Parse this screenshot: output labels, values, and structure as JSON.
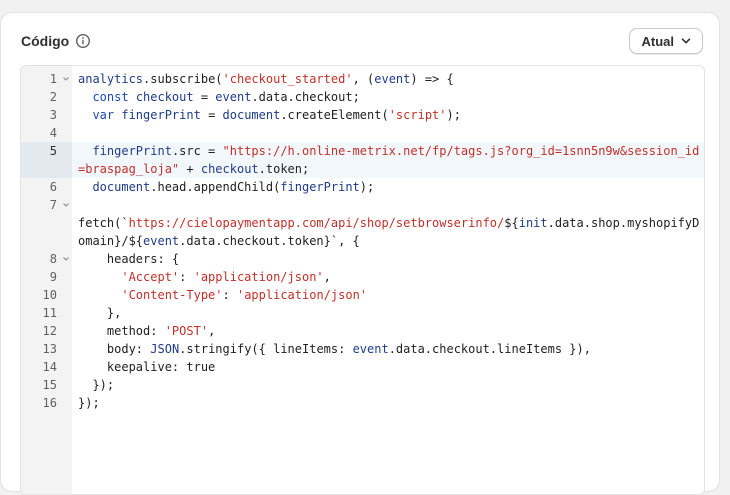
{
  "card": {
    "title": "Código",
    "version_label": "Atual"
  },
  "colors": {
    "keyword": "#1a4bb3",
    "string": "#c0312a",
    "active_line_bg": "#f2f7fc"
  },
  "editor": {
    "active_line": 5,
    "lines": [
      {
        "n": "1",
        "fold": true,
        "tokens": [
          [
            "v",
            "analytics"
          ],
          [
            "",
            "."
          ],
          [
            "",
            "subscribe("
          ],
          [
            "s",
            "'checkout_started'"
          ],
          [
            "",
            ", ("
          ],
          [
            "v",
            "event"
          ],
          [
            "",
            ") => {"
          ]
        ]
      },
      {
        "n": "2",
        "fold": false,
        "tokens": [
          [
            "",
            "  "
          ],
          [
            "k",
            "const "
          ],
          [
            "v",
            "checkout"
          ],
          [
            "",
            " = "
          ],
          [
            "v",
            "event"
          ],
          [
            "",
            ".data.checkout;"
          ]
        ]
      },
      {
        "n": "3",
        "fold": false,
        "tokens": [
          [
            "",
            "  "
          ],
          [
            "k",
            "var "
          ],
          [
            "v",
            "fingerPrint"
          ],
          [
            "",
            " = "
          ],
          [
            "v",
            "document"
          ],
          [
            "",
            ".createElement("
          ],
          [
            "s",
            "'script'"
          ],
          [
            "",
            ");"
          ]
        ]
      },
      {
        "n": "4",
        "fold": false,
        "tokens": []
      },
      {
        "n": "5",
        "fold": false,
        "tokens": [
          [
            "",
            "  "
          ],
          [
            "v",
            "fingerPrint"
          ],
          [
            "",
            ".src = "
          ],
          [
            "s",
            "\"https://h.online-metrix.net/fp/tags.js?org_id=1snn5n9w&session_id=braspag_loja\""
          ],
          [
            "",
            " + "
          ],
          [
            "v",
            "checkout"
          ],
          [
            "",
            ".token;"
          ]
        ]
      },
      {
        "n": "6",
        "fold": false,
        "tokens": [
          [
            "",
            "  "
          ],
          [
            "v",
            "document"
          ],
          [
            "",
            ".head.appendChild("
          ],
          [
            "v",
            "fingerPrint"
          ],
          [
            "",
            ");"
          ]
        ]
      },
      {
        "n": "7",
        "fold": true,
        "tokens": []
      },
      {
        "n": "",
        "fold": false,
        "tokens": [
          [
            "",
            "fetch(`"
          ],
          [
            "s",
            "https://cielopaymentapp.com/api/shop/setbrowserinfo/"
          ],
          [
            "",
            "${"
          ],
          [
            "v",
            "init"
          ],
          [
            "",
            ".data.shop.myshopifyDomain}/${"
          ],
          [
            "v",
            "event"
          ],
          [
            "",
            ".data.checkout.token}`, {"
          ]
        ]
      },
      {
        "n": "8",
        "fold": true,
        "tokens": [
          [
            "",
            "    headers: {"
          ]
        ]
      },
      {
        "n": "9",
        "fold": false,
        "tokens": [
          [
            "",
            "      "
          ],
          [
            "s",
            "'Accept'"
          ],
          [
            "",
            ": "
          ],
          [
            "s",
            "'application/json'"
          ],
          [
            "",
            ","
          ]
        ]
      },
      {
        "n": "10",
        "fold": false,
        "tokens": [
          [
            "",
            "      "
          ],
          [
            "s",
            "'Content-Type'"
          ],
          [
            "",
            ": "
          ],
          [
            "s",
            "'application/json'"
          ]
        ]
      },
      {
        "n": "11",
        "fold": false,
        "tokens": [
          [
            "",
            "    },"
          ]
        ]
      },
      {
        "n": "12",
        "fold": false,
        "tokens": [
          [
            "",
            "    method: "
          ],
          [
            "s",
            "'POST'"
          ],
          [
            "",
            ","
          ]
        ]
      },
      {
        "n": "13",
        "fold": false,
        "tokens": [
          [
            "",
            "    body: "
          ],
          [
            "v",
            "JSON"
          ],
          [
            "",
            ".stringify({ lineItems: "
          ],
          [
            "v",
            "event"
          ],
          [
            "",
            ".data.checkout.lineItems }),"
          ]
        ]
      },
      {
        "n": "14",
        "fold": false,
        "tokens": [
          [
            "",
            "    keepalive: true"
          ]
        ]
      },
      {
        "n": "15",
        "fold": false,
        "tokens": [
          [
            "",
            "  });"
          ]
        ]
      },
      {
        "n": "16",
        "fold": false,
        "tokens": [
          [
            "",
            "});"
          ]
        ]
      }
    ]
  }
}
